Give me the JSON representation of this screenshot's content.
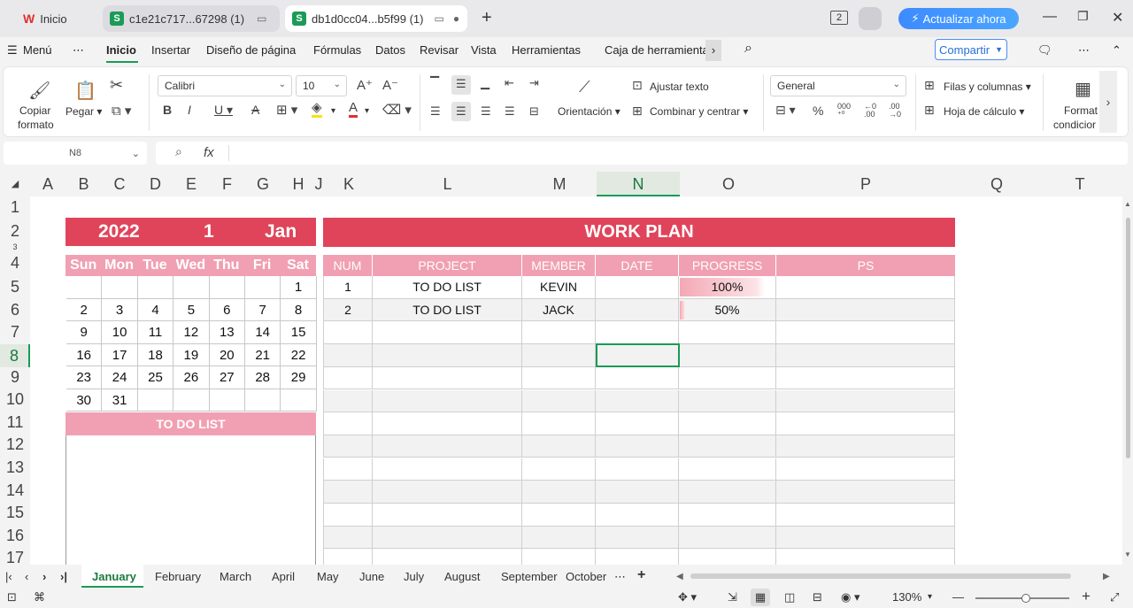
{
  "tabs": [
    {
      "label": "Inicio"
    },
    {
      "label": "c1e21c717...67298 (1)"
    },
    {
      "label": "db1d0cc04...b5f99 (1)"
    }
  ],
  "update_label": "Actualizar ahora",
  "window_badge": "2",
  "menu": {
    "menu_label": "Menú",
    "items": [
      "Inicio",
      "Insertar",
      "Diseño de página",
      "Fórmulas",
      "Datos",
      "Revisar",
      "Vista",
      "Herramientas",
      "Caja de herramienta"
    ],
    "share_label": "Compartir"
  },
  "ribbon": {
    "copy_format": "Copiar formato",
    "copy_line1": "Copiar",
    "copy_line2": "formato",
    "paste": "Pegar",
    "font_name": "Calibri",
    "font_size": "10",
    "orientation": "Orientación",
    "wrap_text": "Ajustar texto",
    "merge_center": "Combinar y centrar",
    "number_format": "General",
    "rows_cols": "Filas y columnas",
    "worksheet": "Hoja de cálculo",
    "cond_format_1": "Format",
    "cond_format_2": "condicior"
  },
  "formula_bar": {
    "cell_ref": "N8",
    "fx": "fx"
  },
  "columns": [
    "A",
    "B",
    "C",
    "D",
    "E",
    "F",
    "G",
    "H",
    "J",
    "K",
    "L",
    "M",
    "N",
    "O",
    "P",
    "Q",
    "T"
  ],
  "rows": [
    "1",
    "2",
    "3",
    "4",
    "5",
    "6",
    "7",
    "8",
    "9",
    "10",
    "11",
    "12",
    "13",
    "14",
    "15",
    "16",
    "17"
  ],
  "calendar": {
    "year": "2022",
    "month_num": "1",
    "month_name": "Jan",
    "weekdays": [
      "Sun",
      "Mon",
      "Tue",
      "Wed",
      "Thu",
      "Fri",
      "Sat"
    ],
    "weeks": [
      [
        "",
        "",
        "",
        "",
        "",
        "",
        "1"
      ],
      [
        "2",
        "3",
        "4",
        "5",
        "6",
        "7",
        "8"
      ],
      [
        "9",
        "10",
        "11",
        "12",
        "13",
        "14",
        "15"
      ],
      [
        "16",
        "17",
        "18",
        "19",
        "20",
        "21",
        "22"
      ],
      [
        "23",
        "24",
        "25",
        "26",
        "27",
        "28",
        "29"
      ],
      [
        "30",
        "31",
        "",
        "",
        "",
        "",
        ""
      ]
    ],
    "todo_title": "TO DO LIST"
  },
  "work_plan": {
    "title": "WORK PLAN",
    "headers": [
      "NUM",
      "PROJECT",
      "MEMBER",
      "DATE",
      "PROGRESS",
      "PS"
    ],
    "rows": [
      {
        "num": "1",
        "project": "TO DO LIST",
        "member": "KEVIN",
        "date": "",
        "progress": "100%",
        "progress_value": 1.0,
        "ps": ""
      },
      {
        "num": "2",
        "project": "TO DO LIST",
        "member": "JACK",
        "date": "",
        "progress": "50%",
        "progress_value": 0.05,
        "ps": ""
      }
    ],
    "empty_rows": 11
  },
  "sheet_tabs": [
    "January",
    "February",
    "March",
    "April",
    "May",
    "June",
    "July",
    "August",
    "September",
    "October"
  ],
  "status": {
    "zoom": "130%"
  },
  "colors": {
    "accent_red": "#e0445a",
    "accent_pink": "#f0a0b2",
    "wps_green": "#1a9b57"
  }
}
